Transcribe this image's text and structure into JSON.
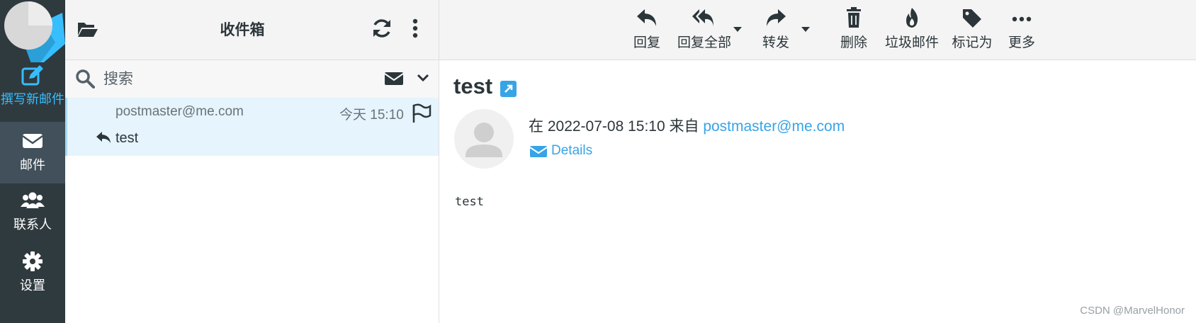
{
  "rail": {
    "compose_label": "撰写新邮件",
    "mail_label": "邮件",
    "contacts_label": "联系人",
    "settings_label": "设置"
  },
  "list": {
    "folder_title": "收件箱",
    "search_placeholder": "搜索",
    "messages": [
      {
        "from": "postmaster@me.com",
        "date": "今天 15:10",
        "subject": "test",
        "replied": true
      }
    ]
  },
  "toolbar": {
    "reply": "回复",
    "reply_all": "回复全部",
    "forward": "转发",
    "delete": "删除",
    "junk": "垃圾邮件",
    "mark": "标记为",
    "more": "更多"
  },
  "message": {
    "title": "test",
    "meta_prefix": "在 2022-07-08 15:10 来自 ",
    "from": "postmaster@me.com",
    "details_label": "Details",
    "body": "test"
  },
  "watermark": "CSDN @MarvelHonor",
  "colors": {
    "accent": "#37beff",
    "link": "#37a4e6",
    "rail_bg": "#2f3a3f",
    "selected_row": "#e5f4fd"
  }
}
